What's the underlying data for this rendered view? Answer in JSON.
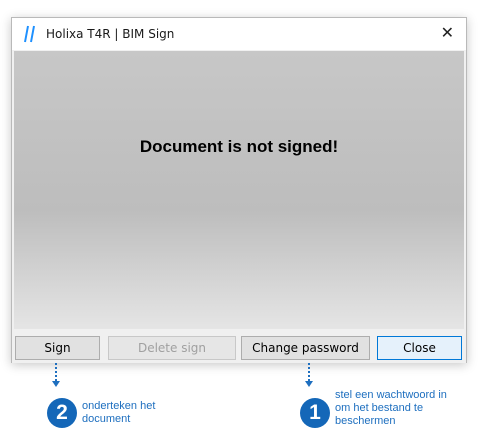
{
  "window": {
    "title": "Holixa T4R | BIM Sign",
    "close_glyph": "✕"
  },
  "content": {
    "status": "Document is not signed!"
  },
  "buttons": {
    "sign": "Sign",
    "delete_sign": "Delete sign",
    "change_password": "Change password",
    "close": "Close"
  },
  "annotations": [
    {
      "number": "2",
      "text_line1": "onderteken het",
      "text_line2": "document"
    },
    {
      "number": "1",
      "text_line1": "stel een wachtwoord in",
      "text_line2": "om het bestand te",
      "text_line3": "beschermen"
    }
  ],
  "colors": {
    "annotation_blue": "#1467b8",
    "primary_border": "#0078d7"
  }
}
